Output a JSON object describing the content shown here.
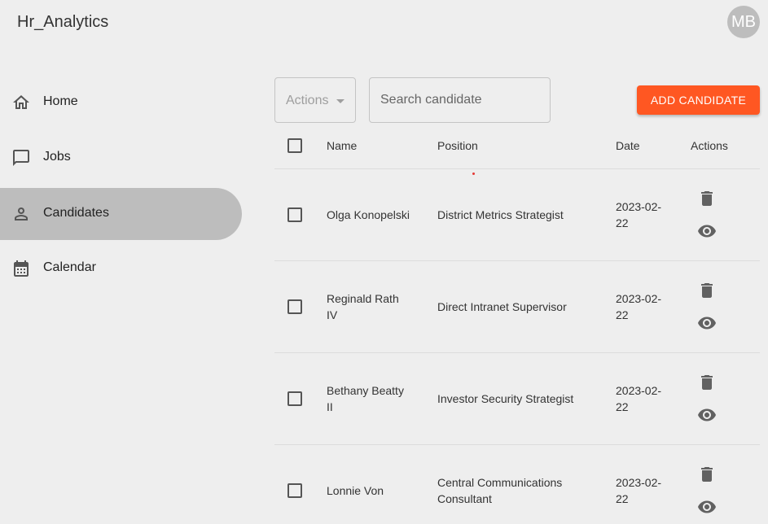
{
  "app": {
    "title": "Hr_Analytics",
    "avatar_initials": "MB"
  },
  "sidebar": {
    "items": [
      {
        "label": "Home",
        "icon": "home-icon",
        "active": false
      },
      {
        "label": "Jobs",
        "icon": "chat-icon",
        "active": false
      },
      {
        "label": "Candidates",
        "icon": "person-icon",
        "active": true
      },
      {
        "label": "Calendar",
        "icon": "calendar-icon",
        "active": false
      }
    ]
  },
  "toolbar": {
    "actions_label": "Actions",
    "search_placeholder": "Search candidate",
    "add_label": "ADD CANDIDATE",
    "add_color": "#ff5722"
  },
  "table": {
    "headers": {
      "name": "Name",
      "position": "Position",
      "date": "Date",
      "actions": "Actions"
    },
    "rows": [
      {
        "name_line1": "Olga Konopelski",
        "name_line2": "",
        "position_line1": "District Metrics Strategist",
        "position_line2": "",
        "date_line1": "2023-02-",
        "date_line2": "22"
      },
      {
        "name_line1": "Reginald Rath",
        "name_line2": "IV",
        "position_line1": "Direct Intranet Supervisor",
        "position_line2": "",
        "date_line1": "2023-02-",
        "date_line2": "22"
      },
      {
        "name_line1": "Bethany Beatty",
        "name_line2": "II",
        "position_line1": "Investor Security Strategist",
        "position_line2": "",
        "date_line1": "2023-02-",
        "date_line2": "22"
      },
      {
        "name_line1": "Lonnie Von",
        "name_line2": "",
        "position_line1": "Central Communications",
        "position_line2": "Consultant",
        "date_line1": "2023-02-",
        "date_line2": "22"
      }
    ],
    "row_icons": [
      "delete-icon",
      "eye-icon"
    ]
  }
}
